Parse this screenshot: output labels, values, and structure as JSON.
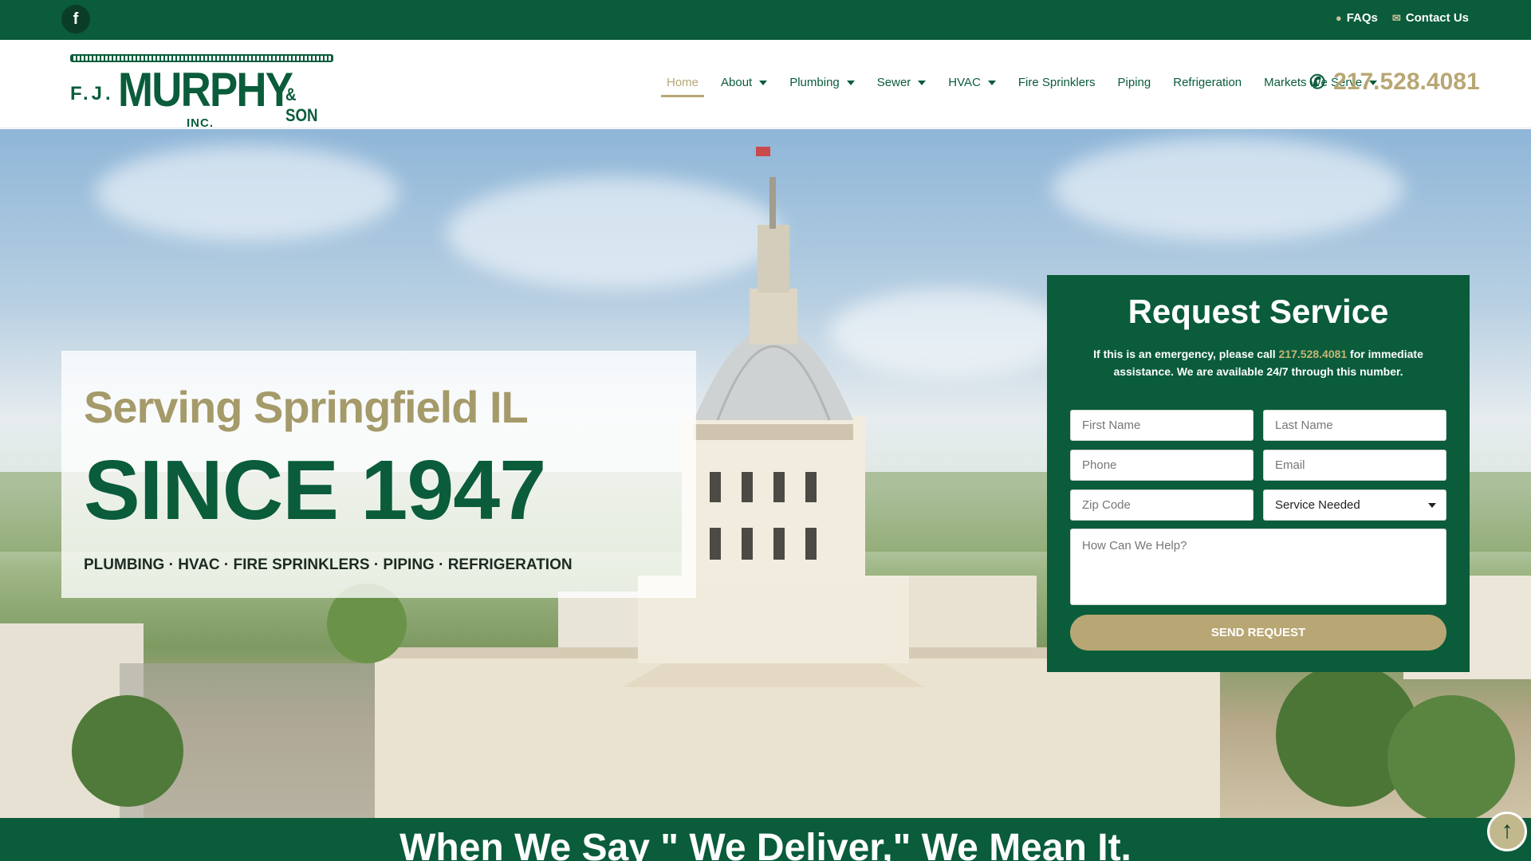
{
  "topbar": {
    "facebook_icon": "facebook-icon",
    "faq_label": "FAQs",
    "contact_label": "Contact Us"
  },
  "logo": {
    "fj": "F.J.",
    "murphy": "MURPHY",
    "son": "& SON",
    "inc": "INC."
  },
  "nav": {
    "items": [
      {
        "label": "Home",
        "active": true,
        "has_menu": false
      },
      {
        "label": "About",
        "has_menu": true
      },
      {
        "label": "Plumbing",
        "has_menu": true
      },
      {
        "label": "Sewer",
        "has_menu": true
      },
      {
        "label": "HVAC",
        "has_menu": true
      },
      {
        "label": "Fire Sprinklers",
        "has_menu": false
      },
      {
        "label": "Piping",
        "has_menu": false
      },
      {
        "label": "Refrigeration",
        "has_menu": false
      },
      {
        "label": "Markets We Serve",
        "has_menu": true
      }
    ],
    "phone": "217.528.4081"
  },
  "hero": {
    "subtitle": "Serving Springfield IL",
    "headline": "SINCE 1947",
    "services": "PLUMBING · HVAC · FIRE SPRINKLERS · PIPING · REFRIGERATION"
  },
  "form": {
    "title": "Request Service",
    "note_before": "If this is an emergency, please call ",
    "note_phone": "217.528.4081",
    "note_after": " for immediate assistance. We are available 24/7 through this number.",
    "first_name_placeholder": "First Name",
    "last_name_placeholder": "Last Name",
    "phone_placeholder": "Phone",
    "email_placeholder": "Email",
    "zip_placeholder": "Zip Code",
    "service_selected": "Service Needed",
    "help_placeholder": "How Can We Help?",
    "submit_label": "SEND REQUEST"
  },
  "band": {
    "text": "When We Say \" We Deliver,\" We Mean It."
  },
  "colors": {
    "brand_green": "#0a5c3b",
    "gold": "#b8a774"
  }
}
